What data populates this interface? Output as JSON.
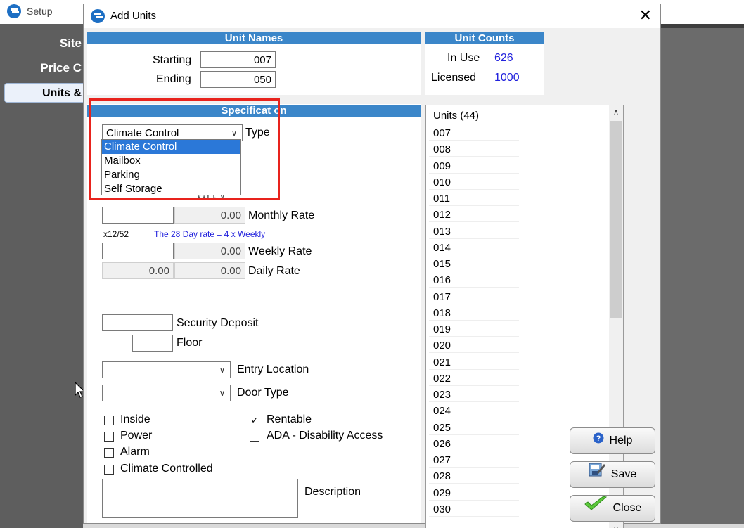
{
  "background": {
    "title": "Setup",
    "sidebar": [
      "Site",
      "Price C",
      "Units &"
    ]
  },
  "dialog": {
    "title": "Add Units",
    "unit_names": {
      "header": "Unit Names",
      "starting_label": "Starting",
      "starting_value": "007",
      "ending_label": "Ending",
      "ending_value": "050"
    },
    "unit_counts": {
      "header": "Unit Counts",
      "in_use_label": "In Use",
      "in_use_value": "626",
      "licensed_label": "Licensed",
      "licensed_value": "1000"
    },
    "specification": {
      "header": "Specificat on",
      "type_value": "Climate Control",
      "type_label": "Type",
      "type_options": [
        "Climate Control",
        "Mailbox",
        "Parking",
        "Self Storage"
      ],
      "partial_label": "Wi t V",
      "monthly_rate_value": "0.00",
      "monthly_rate_label": "Monthly Rate",
      "ratio_text": "x12/52",
      "note_text": "The 28 Day rate = 4 x Weekly",
      "weekly_rate_value": "0.00",
      "weekly_rate_label": "Weekly Rate",
      "daily_rate_left": "0.00",
      "daily_rate_right": "0.00",
      "daily_rate_label": "Daily Rate",
      "security_deposit_label": "Security Deposit",
      "floor_label": "Floor",
      "entry_location_label": "Entry Location",
      "door_type_label": "Door Type",
      "checkboxes_left": [
        {
          "label": "Inside",
          "checked": false
        },
        {
          "label": "Power",
          "checked": false
        },
        {
          "label": "Alarm",
          "checked": false
        },
        {
          "label": "Climate Controlled",
          "checked": false
        }
      ],
      "checkboxes_right": [
        {
          "label": "Rentable",
          "checked": true
        },
        {
          "label": "ADA - Disability Access",
          "checked": false
        }
      ],
      "description_label": "Description"
    },
    "units_list": {
      "header": "Units (44)",
      "items": [
        "007",
        "008",
        "009",
        "010",
        "011",
        "012",
        "013",
        "014",
        "015",
        "016",
        "017",
        "018",
        "019",
        "020",
        "021",
        "022",
        "023",
        "024",
        "025",
        "026",
        "027",
        "028",
        "029",
        "030"
      ]
    },
    "buttons": {
      "help": "Help",
      "save": "Save",
      "close": "Close"
    }
  },
  "colors": {
    "band": "#3b86c9",
    "accent_text": "#2222dd",
    "selection": "#2b78d8",
    "highlight_box": "#e8231d"
  }
}
